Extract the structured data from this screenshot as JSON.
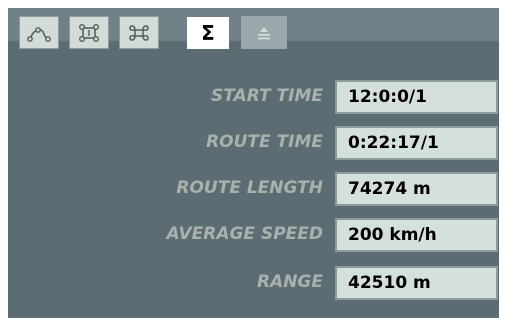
{
  "tabs": [
    {
      "icon": "route-curve-icon",
      "active": false
    },
    {
      "icon": "waypoint-frame-icon",
      "active": false
    },
    {
      "icon": "command-loop-icon",
      "active": false
    },
    {
      "icon": "sigma-icon",
      "label": "Σ",
      "active": true
    },
    {
      "icon": "eject-up-icon",
      "active": false
    }
  ],
  "stats": {
    "start_time": {
      "label": "START TIME",
      "value": "12:0:0/1"
    },
    "route_time": {
      "label": "ROUTE TIME",
      "value": "0:22:17/1"
    },
    "route_length": {
      "label": "ROUTE LENGTH",
      "value": "74274 m"
    },
    "average_speed": {
      "label": "AVERAGE SPEED",
      "value": "200 km/h"
    },
    "range": {
      "label": "RANGE",
      "value": "42510 m"
    }
  },
  "colors": {
    "panel": "#5c6c73",
    "tabbar": "#708087",
    "label_text": "#a8b1ac",
    "value_bg": "#d5e0dc",
    "value_border": "#8e9b9d"
  }
}
